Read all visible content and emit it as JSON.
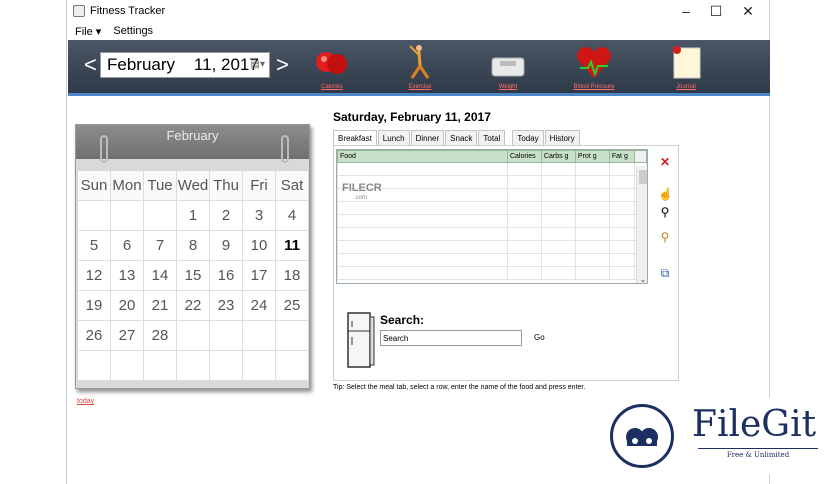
{
  "window": {
    "title": "Fitness Tracker"
  },
  "menu": {
    "file": "File ▾",
    "settings": "Settings"
  },
  "date": {
    "prev": "<",
    "next": ">",
    "value": "February    11, 2017",
    "dropdown": "▤▾"
  },
  "toolbar": {
    "calories": "Calories",
    "exercise": "Exercise",
    "weight": "Weight",
    "blood_pressure": "Blood Pressure",
    "journal": "Journal"
  },
  "calendar": {
    "month": "February",
    "weekdays": [
      "Sun",
      "Mon",
      "Tue",
      "Wed",
      "Thu",
      "Fri",
      "Sat"
    ],
    "days": [
      "",
      "",
      "",
      "1",
      "2",
      "3",
      "4",
      "5",
      "6",
      "7",
      "8",
      "9",
      "10",
      "11",
      "12",
      "13",
      "14",
      "15",
      "16",
      "17",
      "18",
      "19",
      "20",
      "21",
      "22",
      "23",
      "24",
      "25",
      "26",
      "27",
      "28",
      "",
      "",
      "",
      "",
      "",
      "",
      "",
      "",
      "",
      "",
      ""
    ],
    "selected_day": "11",
    "today_link": "today"
  },
  "day_title": "Saturday, February 11, 2017",
  "tabs": [
    "Breakfast",
    "Lunch",
    "Dinner",
    "Snack",
    "Total",
    "Today",
    "History"
  ],
  "food_grid": {
    "columns": [
      "Food",
      "Calories",
      "Carbs g",
      "Prot g",
      "Fat g"
    ],
    "rows": 9
  },
  "search": {
    "label": "Search:",
    "value": "Search",
    "go": "Go"
  },
  "tip": "Tip: Select the meal tab, select a row, enter the name of the food and press enter.",
  "watermarks": {
    "filecr": "FILECR",
    "filecr_sub": ".com",
    "filegit": "FileGit",
    "filegit_sub": "Free & Unlimited"
  },
  "colors": {
    "toolbar_bg": "#2f3a48",
    "accent": "#4a86c8",
    "grid_header": "#c8e0c8",
    "link": "#ff6a6a",
    "watermark": "#1b2f60"
  }
}
